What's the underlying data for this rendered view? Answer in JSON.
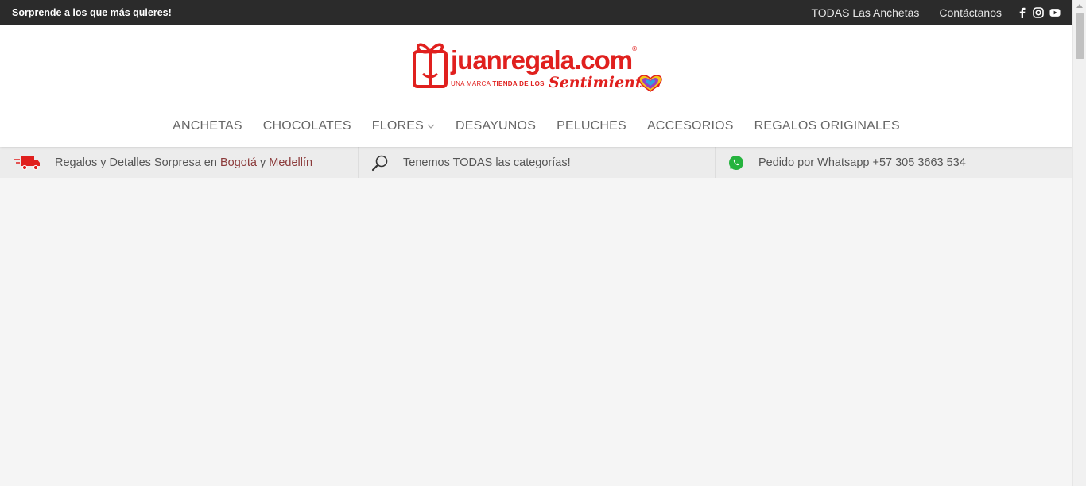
{
  "topbar": {
    "promo": "Sorprende a los que más quieres!",
    "links": [
      "TODAS Las Anchetas",
      "Contáctanos"
    ],
    "socials": [
      "facebook-icon",
      "instagram-icon",
      "youtube-icon"
    ]
  },
  "logo": {
    "brand": "juanregala.com",
    "registered": "®",
    "tag_prefix": "UNA MARCA ",
    "tag_bold": "TIENDA DE LOS",
    "script": "Sentimientos"
  },
  "nav": {
    "items": [
      "ANCHETAS",
      "CHOCOLATES",
      "FLORES",
      "DESAYUNOS",
      "PELUCHES",
      "ACCESORIOS",
      "REGALOS ORIGINALES"
    ]
  },
  "infobar": {
    "delivery_text": "Regalos y Detalles Sorpresa en ",
    "city1": "Bogotá",
    "and": " y ",
    "city2": "Medellín",
    "categories_text": "Tenemos TODAS las categorías!",
    "whatsapp_text": "Pedido por Whatsapp +57 305 3663 534"
  },
  "colors": {
    "brand_red": "#e0201e",
    "topbar_bg": "#2b2b2b",
    "whatsapp_green": "#25b33e",
    "link_maroon": "#8b3a3a"
  }
}
